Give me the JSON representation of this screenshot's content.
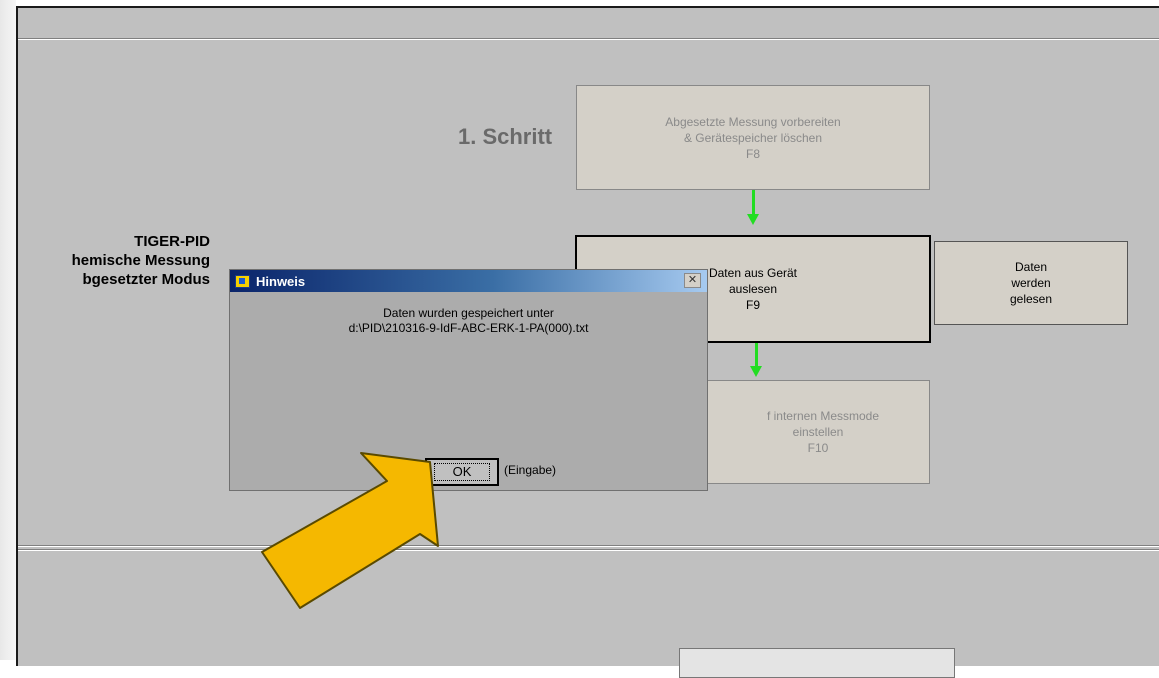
{
  "title_block": {
    "line1": "TIGER-PID",
    "line2": "hemische Messung",
    "line3": "bgesetzter Modus"
  },
  "step": {
    "label": "1. Schritt"
  },
  "buttons": {
    "prepare": {
      "line1": "Abgesetzte Messung vorbereiten",
      "line2": "& Gerätespeicher löschen",
      "key": "F8"
    },
    "read": {
      "line1": "Daten aus Gerät",
      "line2": "auslesen",
      "key": "F9"
    },
    "mode": {
      "line1": "f internen Messmode",
      "line2": "einstellen",
      "key": "F10"
    }
  },
  "status": {
    "line1": "Daten",
    "line2": "werden",
    "line3": "gelesen"
  },
  "dialog": {
    "title": "Hinweis",
    "close_symbol": "✕",
    "message_line1": "Daten wurden gespeichert unter",
    "message_line2": "d:\\PID\\210316-9-IdF-ABC-ERK-1-PA(000).txt",
    "ok_label": "OK",
    "ok_hint": "(Eingabe)"
  },
  "colors": {
    "panel": "#c0c0c0",
    "arrow_green": "#22dd22",
    "callout_arrow": "#f5b800",
    "titlebar_start": "#0a246a",
    "titlebar_end": "#a6caf0"
  },
  "icons": {
    "dialog_icon": "labview-app-icon",
    "close": "close-icon",
    "callout": "pointer-arrow-icon"
  }
}
